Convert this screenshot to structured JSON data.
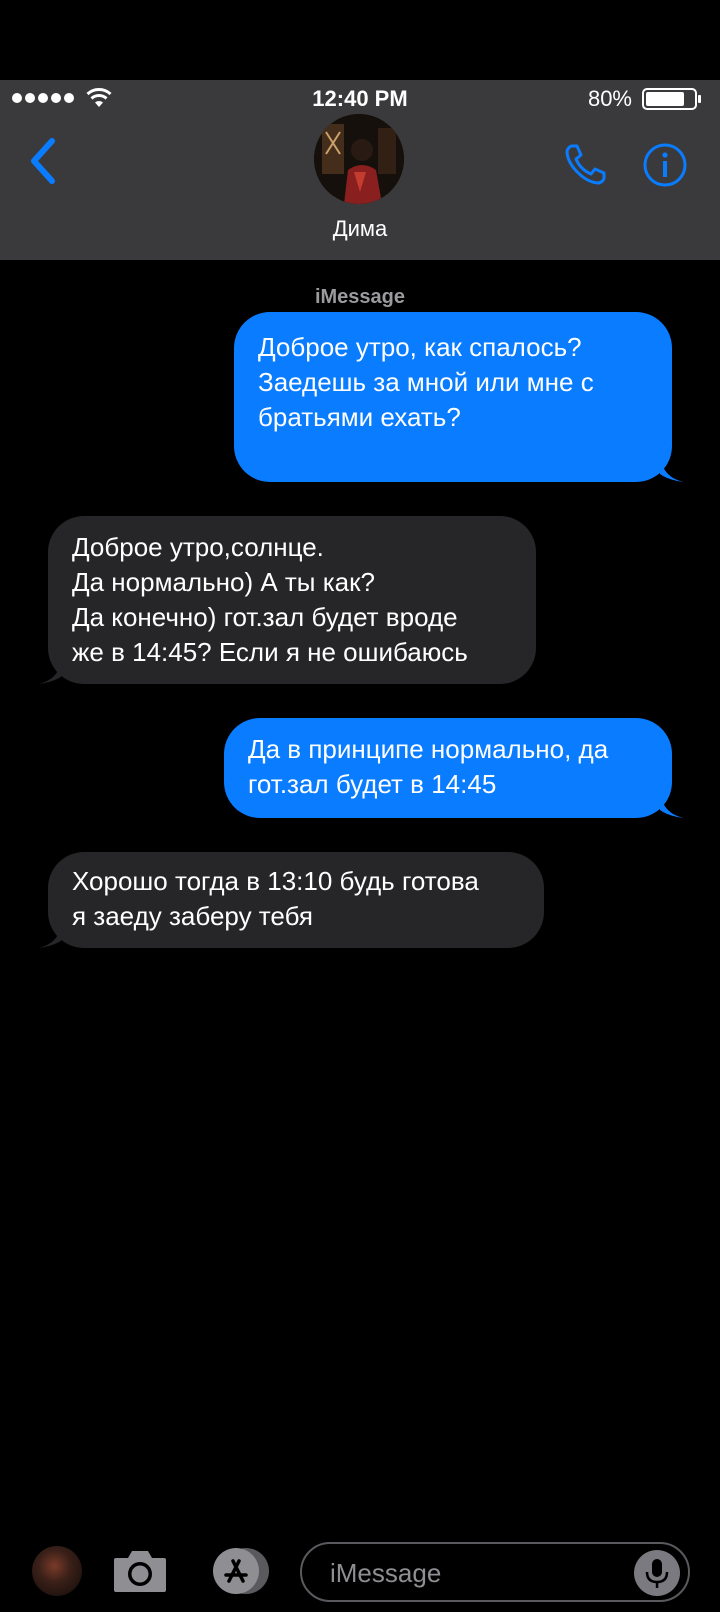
{
  "status_bar": {
    "time": "12:40 PM",
    "battery": "80%"
  },
  "header": {
    "contact_name": "Дима",
    "back_icon": "chevron-left-icon",
    "call_icon": "phone-icon",
    "info_icon": "info-icon"
  },
  "conversation": {
    "service_label": "iMessage",
    "messages": [
      {
        "direction": "outgoing",
        "text": "Доброе утро, как спалось?\nЗаедешь за мной или мне с\nбратьями ехать?"
      },
      {
        "direction": "incoming",
        "text": "Доброе утро,солнце.\nДа нормально) А ты как?\nДа конечно) гот.зал будет вроде\nже в 14:45? Если я не ошибаюсь"
      },
      {
        "direction": "outgoing",
        "text": "Да в принципе нормально, да\nгот.зал будет в 14:45"
      },
      {
        "direction": "incoming",
        "text": "Хорошо тогда в 13:10 будь готова\nя заеду заберу тебя"
      }
    ]
  },
  "compose": {
    "placeholder": "iMessage",
    "camera_icon": "camera-icon",
    "apps_icon": "app-store-icon",
    "mic_icon": "microphone-icon"
  },
  "colors": {
    "accent": "#0a7cff",
    "header_bg": "#3a3a3c",
    "incoming_bubble": "#262629",
    "outgoing_bubble": "#0a7cff"
  }
}
